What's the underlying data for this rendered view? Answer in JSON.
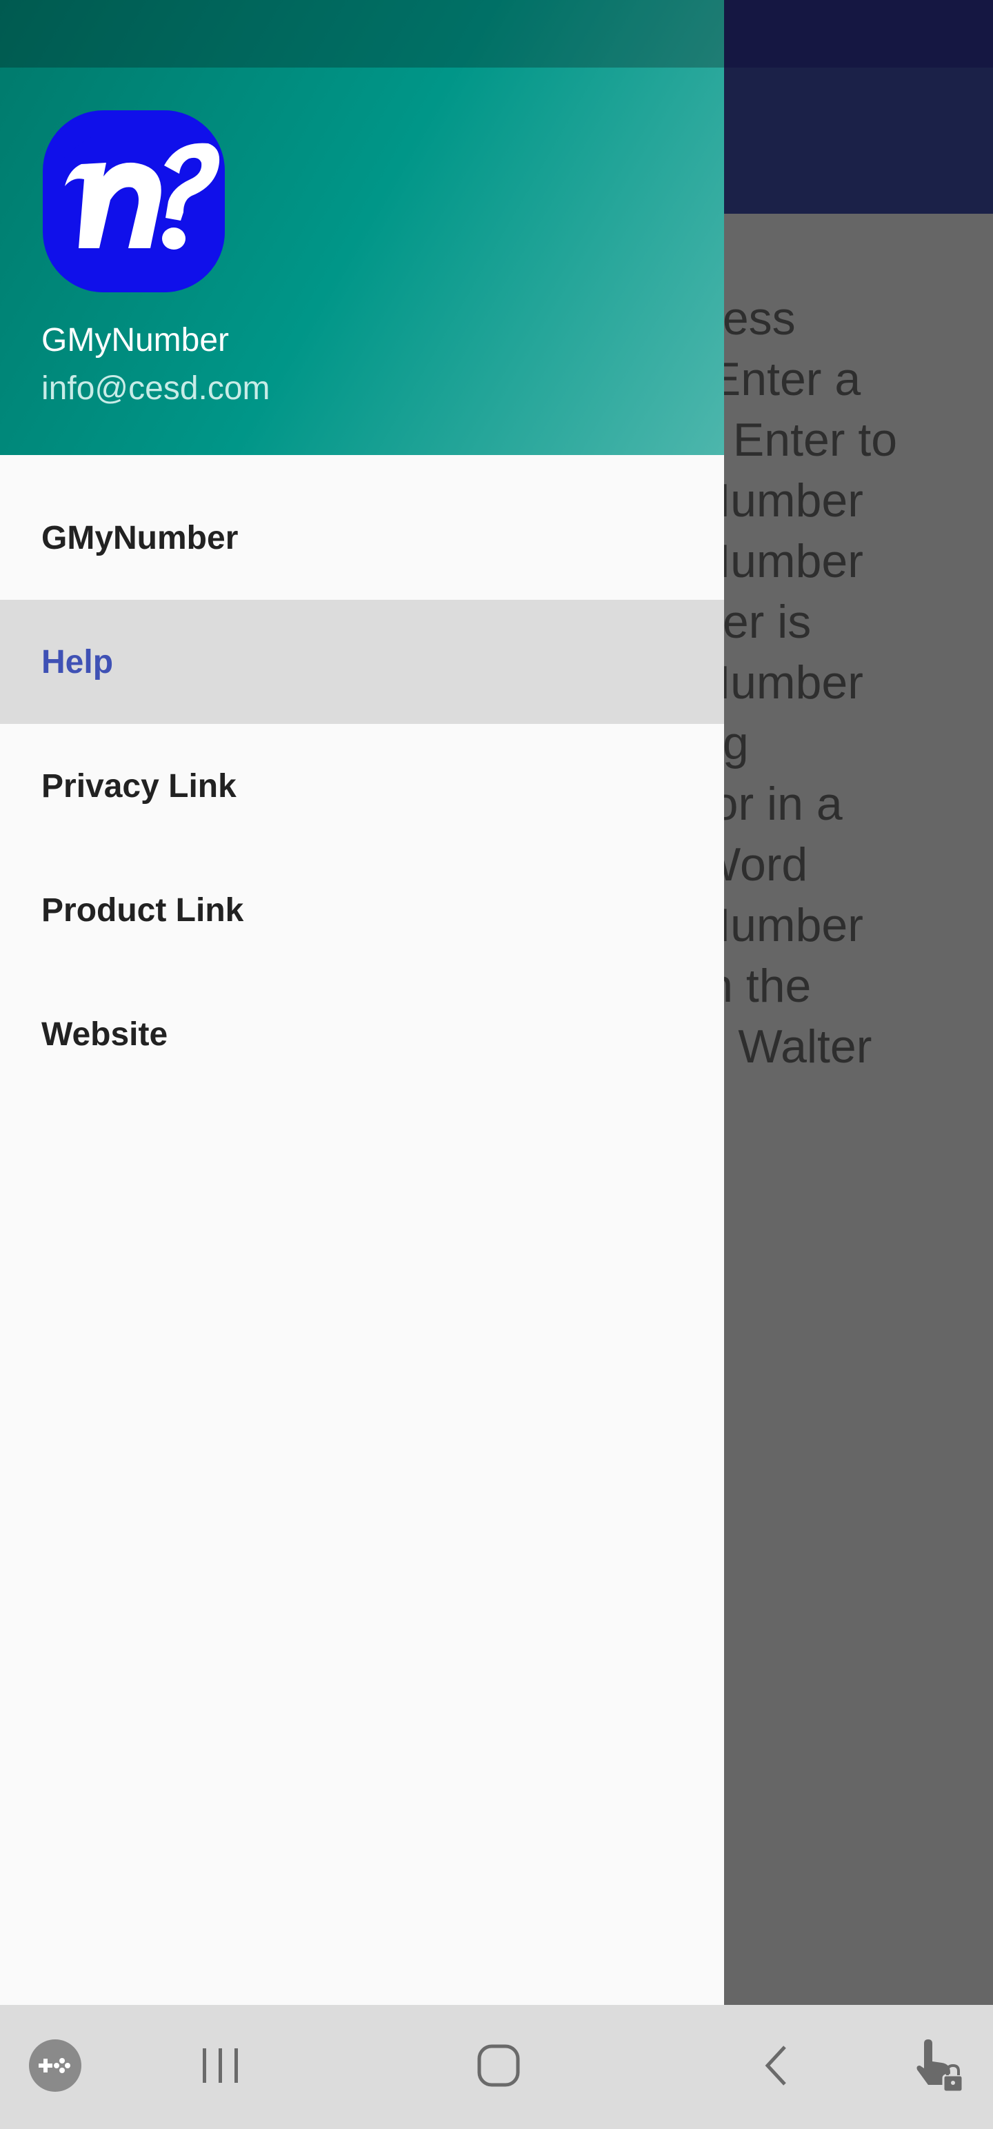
{
  "background": {
    "content_lines": [
      "uess",
      ".Enter a",
      "s Enter to",
      " Number",
      " Number",
      "ber is",
      " Number",
      "ng",
      " (or in a",
      " Word",
      "Number",
      "in the",
      "r: Walter"
    ]
  },
  "drawer": {
    "header": {
      "app_name": "GMyNumber",
      "email": "info@cesd.com",
      "logo_icon": "n?-logo"
    },
    "menu": [
      {
        "label": "GMyNumber",
        "active": false
      },
      {
        "label": "Help",
        "active": true
      },
      {
        "label": "Privacy Link",
        "active": false
      },
      {
        "label": "Product Link",
        "active": false
      },
      {
        "label": "Website",
        "active": false
      }
    ]
  },
  "navbar": {
    "icons": [
      "game-launcher-icon",
      "recent-apps-icon",
      "home-icon",
      "back-icon",
      "touch-lock-icon"
    ]
  },
  "colors": {
    "header_accent": "#009688",
    "active_item_text": "#3f51b5",
    "logo_bg": "#1010ea"
  }
}
